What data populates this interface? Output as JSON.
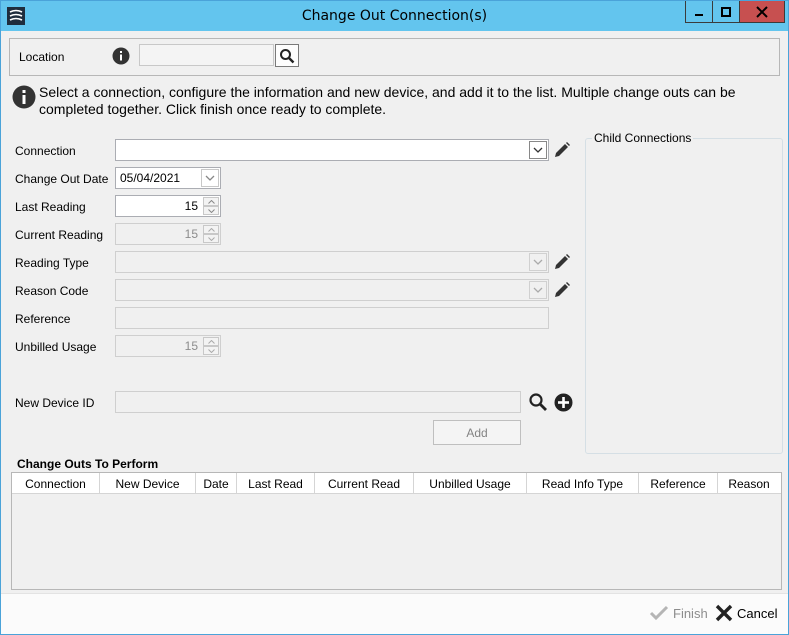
{
  "window": {
    "title": "Change Out Connection(s)"
  },
  "location": {
    "label": "Location",
    "value": ""
  },
  "info": {
    "text": "Select a connection, configure the information and new device, and add it to the list.  Multiple change outs can be completed together.  Click finish once ready to complete."
  },
  "form": {
    "connection_label": "Connection",
    "connection_value": "",
    "change_out_date_label": "Change Out Date",
    "change_out_date_value": "05/04/2021",
    "last_reading_label": "Last Reading",
    "last_reading_value": "15",
    "current_reading_label": "Current Reading",
    "current_reading_value": "15",
    "reading_type_label": "Reading Type",
    "reading_type_value": "",
    "reason_code_label": "Reason Code",
    "reason_code_value": "",
    "reference_label": "Reference",
    "reference_value": "",
    "unbilled_usage_label": "Unbilled Usage",
    "unbilled_usage_value": "15",
    "new_device_label": "New Device ID",
    "new_device_value": "",
    "add_label": "Add"
  },
  "child_connections": {
    "title": "Child Connections"
  },
  "grid": {
    "title": "Change Outs To Perform",
    "columns": [
      "Connection",
      "New Device",
      "Date",
      "Last Read",
      "Current Read",
      "Unbilled Usage",
      "Read Info Type",
      "Reference",
      "Reason"
    ]
  },
  "footer": {
    "finish_label": "Finish",
    "cancel_label": "Cancel"
  },
  "colors": {
    "titlebar": "#63c5ee",
    "close": "#c75050"
  }
}
